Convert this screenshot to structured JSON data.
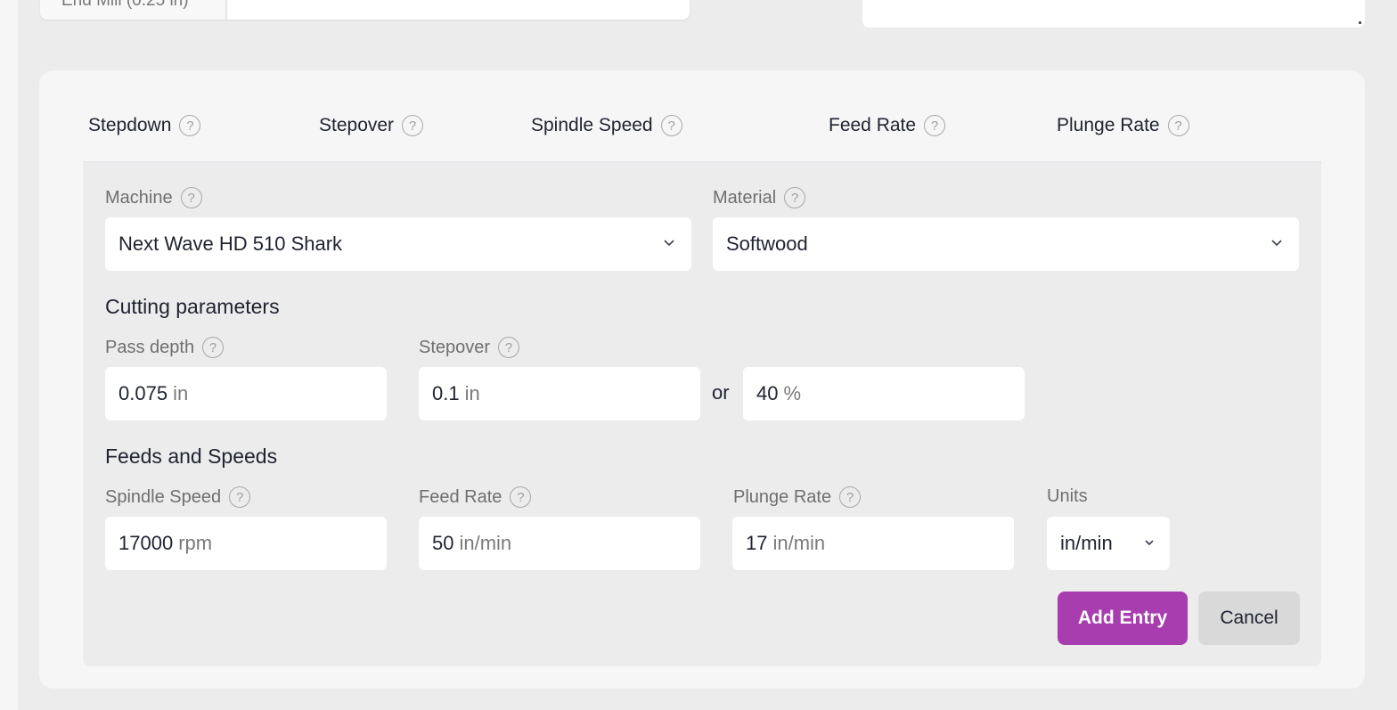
{
  "top": {
    "tool_label": "End Mill (0.25 in)",
    "tool_value": "",
    "notes_value": ""
  },
  "columns": [
    {
      "label": "Stepdown",
      "icon": "help-icon"
    },
    {
      "label": "Stepover",
      "icon": "help-icon"
    },
    {
      "label": "Spindle Speed",
      "icon": "help-icon"
    },
    {
      "label": "Feed Rate",
      "icon": "help-icon"
    },
    {
      "label": "Plunge Rate",
      "icon": "help-icon"
    }
  ],
  "help_glyph": "?",
  "form": {
    "machine": {
      "label": "Machine",
      "value": "Next Wave HD 510 Shark"
    },
    "material": {
      "label": "Material",
      "value": "Softwood"
    },
    "cutting_title": "Cutting parameters",
    "pass_depth": {
      "label": "Pass depth",
      "value": "0.075",
      "unit": "in"
    },
    "stepover": {
      "label": "Stepover",
      "value": "0.1",
      "unit": "in"
    },
    "or_text": "or",
    "stepover_pct": {
      "value": "40",
      "unit": "%"
    },
    "feeds_title": "Feeds and Speeds",
    "spindle_speed": {
      "label": "Spindle Speed",
      "value": "17000",
      "unit": "rpm"
    },
    "feed_rate": {
      "label": "Feed Rate",
      "value": "50",
      "unit": "in/min"
    },
    "plunge_rate": {
      "label": "Plunge Rate",
      "value": "17",
      "unit": "in/min"
    },
    "units": {
      "label": "Units",
      "value": "in/min"
    }
  },
  "actions": {
    "add_entry": "Add Entry",
    "cancel": "Cancel"
  },
  "colors": {
    "primary": "#a83db0",
    "secondary": "#d9d9d9"
  }
}
